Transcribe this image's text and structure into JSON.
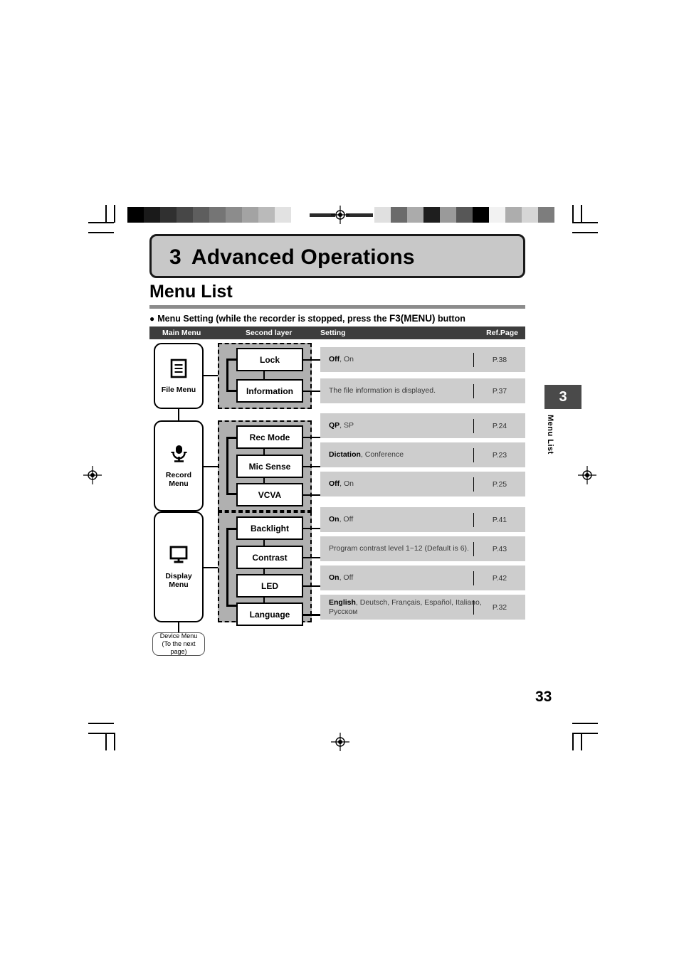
{
  "chapter": {
    "number": "3",
    "title": "Advanced Operations"
  },
  "section": {
    "title": "Menu List"
  },
  "bullet": {
    "text_before": "Menu Setting (while the recorder is stopped, press the ",
    "key": "F3(MENU)",
    "text_after": " button"
  },
  "table": {
    "headers": {
      "main_menu": "Main Menu",
      "second_layer": "Second layer",
      "setting": "Setting",
      "ref_page": "Ref.Page"
    }
  },
  "menus": [
    {
      "id": "file-menu",
      "label": "File Menu",
      "icon": "document-icon",
      "items": [
        {
          "label": "Lock",
          "setting_bold": "Off",
          "setting_rest": ", On",
          "ref_page": "P.38"
        },
        {
          "label": "Information",
          "setting_bold": "",
          "setting_rest": "The file information is displayed.",
          "ref_page": "P.37"
        }
      ]
    },
    {
      "id": "record-menu",
      "label": "Record\nMenu",
      "icon": "microphone-icon",
      "items": [
        {
          "label": "Rec Mode",
          "setting_bold": "QP",
          "setting_rest": ", SP",
          "ref_page": "P.24"
        },
        {
          "label": "Mic Sense",
          "setting_bold": "Dictation",
          "setting_rest": ", Conference",
          "ref_page": "P.23"
        },
        {
          "label": "VCVA",
          "setting_bold": "Off",
          "setting_rest": ", On",
          "ref_page": "P.25"
        }
      ]
    },
    {
      "id": "display-menu",
      "label": "Display\nMenu",
      "icon": "monitor-icon",
      "items": [
        {
          "label": "Backlight",
          "setting_bold": "On",
          "setting_rest": ", Off",
          "ref_page": "P.41"
        },
        {
          "label": "Contrast",
          "setting_bold": "",
          "setting_rest": "Program contrast level 1~12 (Default is 6).",
          "ref_page": "P.43"
        },
        {
          "label": "LED",
          "setting_bold": "On",
          "setting_rest": ", Off",
          "ref_page": "P.42"
        },
        {
          "label": "Language",
          "setting_bold": "English",
          "setting_rest": ", Deutsch, Français, Español, Italiano, Русском",
          "ref_page": "P.32"
        }
      ]
    }
  ],
  "device_menu": {
    "line1": "Device Menu",
    "line2": "(To the next page)"
  },
  "side_tab": {
    "number": "3",
    "label": "Menu List"
  },
  "page_number": "33",
  "colors": {
    "banner_fill": "#c8c8c8",
    "table_header": "#3d3d3d",
    "group_fill": "#b0b0b0",
    "setting_fill": "#cdcdcd",
    "rule": "#8c8c8c",
    "side_tab": "#4a4a4a"
  },
  "print_marks": {
    "left_swatches": [
      "#000000",
      "#1a1a1a",
      "#303030",
      "#474747",
      "#5e5e5e",
      "#757575",
      "#8c8c8c",
      "#a3a3a3",
      "#bababa",
      "#e2e2e2",
      "#ffffff"
    ],
    "right_swatches": [
      "#e0e0e0",
      "#6b6b6b",
      "#ababab",
      "#1e1e1e",
      "#9a9a9a",
      "#575757",
      "#000000",
      "#f2f2f2",
      "#adadad",
      "#d6d6d6",
      "#7d7d7d"
    ]
  }
}
